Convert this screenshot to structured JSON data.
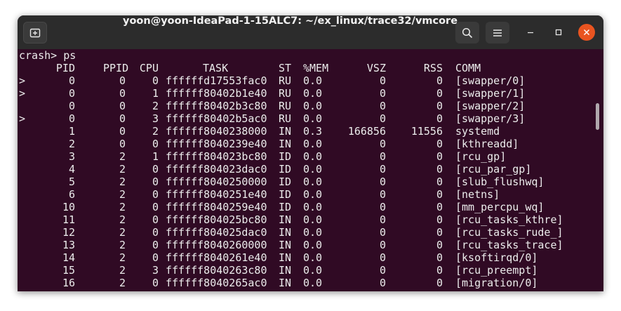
{
  "window": {
    "title": "yoon@yoon-IdeaPad-1-15ALC7: ~/ex_linux/trace32/vmcore",
    "accent_close": "#e95420",
    "terminal_bg": "#300a24"
  },
  "icons": {
    "new_tab": "new-tab-icon",
    "search": "search-icon",
    "menu": "hamburger-menu-icon",
    "minimize": "minimize-icon",
    "maximize": "maximize-icon",
    "close": "close-icon"
  },
  "terminal": {
    "prompt": "crash> ps",
    "headers": [
      "PID",
      "PPID",
      "CPU",
      "TASK",
      "ST",
      "%MEM",
      "VSZ",
      "RSS",
      "COMM"
    ],
    "rows": [
      [
        ">",
        "0",
        "0",
        "0",
        "ffffffd17553fac0",
        "RU",
        "0.0",
        "0",
        "0",
        "[swapper/0]"
      ],
      [
        ">",
        "0",
        "0",
        "1",
        "ffffff80402b1e40",
        "RU",
        "0.0",
        "0",
        "0",
        "[swapper/1]"
      ],
      [
        "",
        "0",
        "0",
        "2",
        "ffffff80402b3c80",
        "RU",
        "0.0",
        "0",
        "0",
        "[swapper/2]"
      ],
      [
        ">",
        "0",
        "0",
        "3",
        "ffffff80402b5ac0",
        "RU",
        "0.0",
        "0",
        "0",
        "[swapper/3]"
      ],
      [
        "",
        "1",
        "0",
        "2",
        "ffffff8040238000",
        "IN",
        "0.3",
        "166856",
        "11556",
        "systemd"
      ],
      [
        "",
        "2",
        "0",
        "0",
        "ffffff8040239e40",
        "IN",
        "0.0",
        "0",
        "0",
        "[kthreadd]"
      ],
      [
        "",
        "3",
        "2",
        "1",
        "ffffff804023bc80",
        "ID",
        "0.0",
        "0",
        "0",
        "[rcu_gp]"
      ],
      [
        "",
        "4",
        "2",
        "0",
        "ffffff804023dac0",
        "ID",
        "0.0",
        "0",
        "0",
        "[rcu_par_gp]"
      ],
      [
        "",
        "5",
        "2",
        "0",
        "ffffff8040250000",
        "ID",
        "0.0",
        "0",
        "0",
        "[slub_flushwq]"
      ],
      [
        "",
        "6",
        "2",
        "0",
        "ffffff8040251e40",
        "ID",
        "0.0",
        "0",
        "0",
        "[netns]"
      ],
      [
        "",
        "10",
        "2",
        "0",
        "ffffff8040259e40",
        "ID",
        "0.0",
        "0",
        "0",
        "[mm_percpu_wq]"
      ],
      [
        "",
        "11",
        "2",
        "0",
        "ffffff804025bc80",
        "IN",
        "0.0",
        "0",
        "0",
        "[rcu_tasks_kthre]"
      ],
      [
        "",
        "12",
        "2",
        "0",
        "ffffff804025dac0",
        "IN",
        "0.0",
        "0",
        "0",
        "[rcu_tasks_rude_]"
      ],
      [
        "",
        "13",
        "2",
        "0",
        "ffffff8040260000",
        "IN",
        "0.0",
        "0",
        "0",
        "[rcu_tasks_trace]"
      ],
      [
        "",
        "14",
        "2",
        "0",
        "ffffff8040261e40",
        "IN",
        "0.0",
        "0",
        "0",
        "[ksoftirqd/0]"
      ],
      [
        "",
        "15",
        "2",
        "3",
        "ffffff8040263c80",
        "IN",
        "0.0",
        "0",
        "0",
        "[rcu_preempt]"
      ],
      [
        "",
        "16",
        "2",
        "0",
        "ffffff8040265ac0",
        "IN",
        "0.0",
        "0",
        "0",
        "[migration/0]"
      ]
    ]
  }
}
